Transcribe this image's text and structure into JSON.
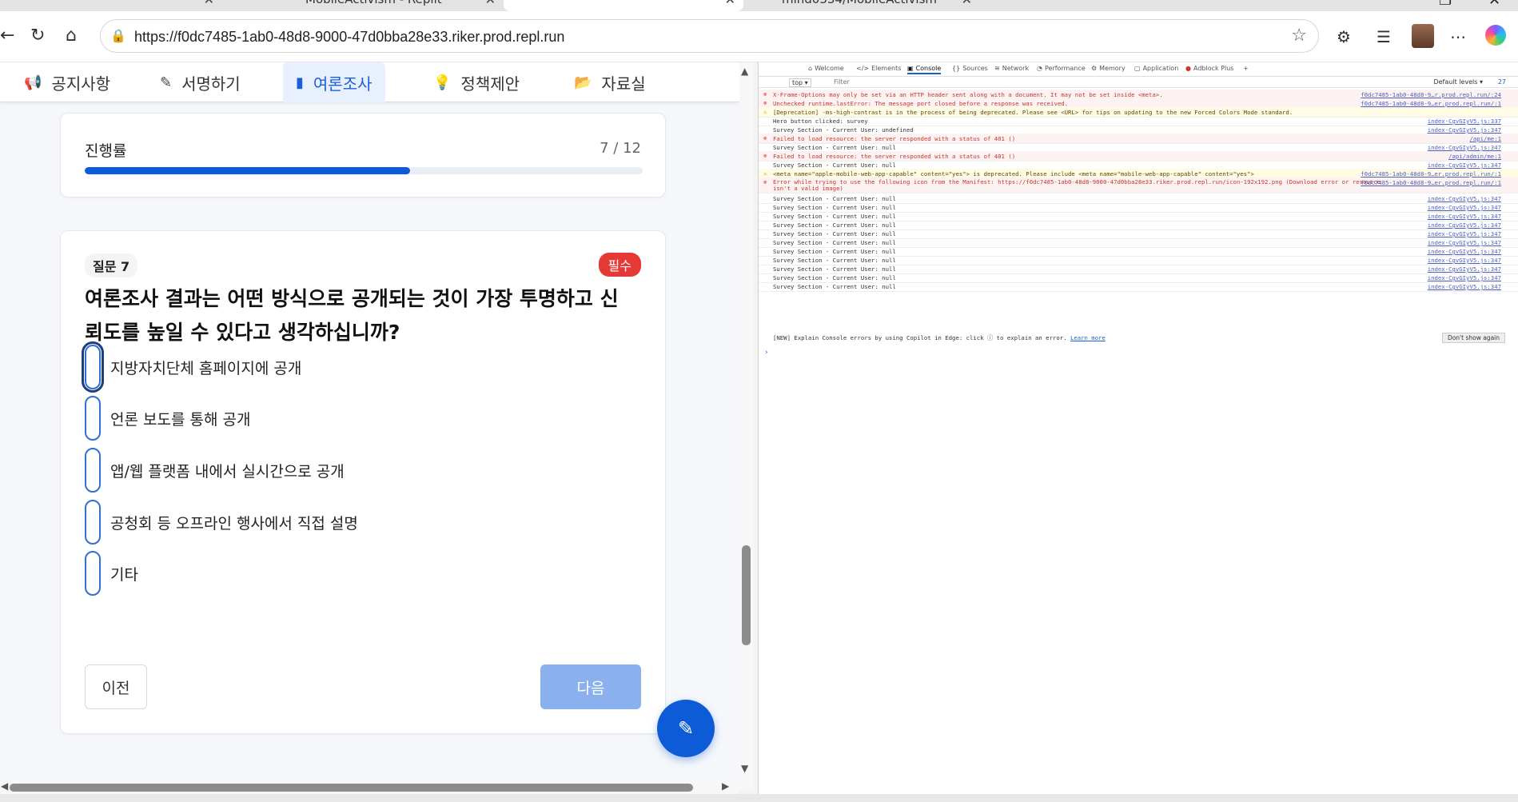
{
  "browser": {
    "tabs": [
      {
        "label": "",
        "active": false
      },
      {
        "label": "MobileActivism - Replit",
        "active": false
      },
      {
        "label": "",
        "active": true
      },
      {
        "label": "mind0334/MobileActivism",
        "active": false
      }
    ],
    "url": "https://f0dc7485-1ab0-48d8-9000-47d0bba28e33.riker.prod.repl.run"
  },
  "site_nav": {
    "items": [
      {
        "label": "공지사항",
        "icon": "megaphone-icon"
      },
      {
        "label": "서명하기",
        "icon": "pen-icon"
      },
      {
        "label": "여론조사",
        "icon": "bar-chart-icon",
        "active": true
      },
      {
        "label": "정책제안",
        "icon": "lightbulb-icon"
      },
      {
        "label": "자료실",
        "icon": "folder-icon"
      }
    ]
  },
  "progress": {
    "label": "진행률",
    "count": "7 / 12",
    "fraction": 0.583
  },
  "question": {
    "number_label": "질문 7",
    "required_label": "필수",
    "text": "여론조사 결과는 어떤 방식으로 공개되는 것이 가장 투명하고 신뢰도를 높일 수 있다고 생각하십니까?",
    "options": [
      "지방자치단체 홈페이지에 공개",
      "언론 보도를 통해 공개",
      "앱/웹 플랫폼 내에서 실시간으로 공개",
      "공청회 등 오프라인 행사에서 직접 설명",
      "기타"
    ],
    "prev_label": "이전",
    "next_label": "다음"
  },
  "devtools": {
    "tabs": [
      "Welcome",
      "Elements",
      "Console",
      "Sources",
      "Network",
      "Performance",
      "Memory",
      "Application",
      "Adblock Plus"
    ],
    "active_tab": "Console",
    "context": "top ▾",
    "filter_placeholder": "Filter",
    "levels": "Default levels ▾",
    "issue_count": "27",
    "logs": [
      {
        "type": "err",
        "msg": "X-Frame-Options may only be set via an HTTP header sent along with a document. It may not be set inside <meta>.",
        "src": "f0dc7485-1ab0-48d8-9…r.prod.repl.run/:24"
      },
      {
        "type": "err",
        "msg": "Unchecked runtime.lastError: The message port closed before a response was received.",
        "src": "f0dc7485-1ab0-48d8-9…er.prod.repl.run/:1"
      },
      {
        "type": "warn",
        "msg": "[Deprecation] -ms-high-contrast is in the process of being deprecated. Please see <URL> for tips on updating to the new Forced Colors Mode standard.",
        "src": ""
      },
      {
        "type": "info",
        "msg": "Hero button clicked: survey",
        "src": "index-CgvGIyV5.js:337"
      },
      {
        "type": "info",
        "msg": "Survey Section - Current User: undefined",
        "src": "index-CgvGIyV5.js:347"
      },
      {
        "type": "err",
        "msg": "Failed to load resource: the server responded with a status of 401 ()",
        "src": "/api/me:1"
      },
      {
        "type": "info",
        "msg": "Survey Section - Current User: null",
        "src": "index-CgvGIyV5.js:347"
      },
      {
        "type": "err",
        "msg": "Failed to load resource: the server responded with a status of 401 ()",
        "src": "/api/admin/me:1"
      },
      {
        "type": "info",
        "msg": "Survey Section - Current User: null",
        "src": "index-CgvGIyV5.js:347"
      },
      {
        "type": "warn",
        "msg": "<meta name=\"apple-mobile-web-app-capable\" content=\"yes\"> is deprecated. Please include <meta name=\"mobile-web-app-capable\" content=\"yes\">",
        "src": "f0dc7485-1ab0-48d8-9…er.prod.repl.run/:1"
      },
      {
        "type": "err",
        "msg": "Error while trying to use the following icon from the Manifest: https://f0dc7485-1ab0-48d8-9000-47d0bba28e33.riker.prod.repl.run/icon-192x192.png (Download error or resource isn't a valid image)",
        "src": "f0dc7485-1ab0-48d8-9…er.prod.repl.run/:1"
      },
      {
        "type": "info",
        "msg": "Survey Section - Current User: null",
        "src": "index-CgvGIyV5.js:347"
      },
      {
        "type": "info",
        "msg": "Survey Section - Current User: null",
        "src": "index-CgvGIyV5.js:347"
      },
      {
        "type": "info",
        "msg": "Survey Section - Current User: null",
        "src": "index-CgvGIyV5.js:347"
      },
      {
        "type": "info",
        "msg": "Survey Section - Current User: null",
        "src": "index-CgvGIyV5.js:347"
      },
      {
        "type": "info",
        "msg": "Survey Section - Current User: null",
        "src": "index-CgvGIyV5.js:347"
      },
      {
        "type": "info",
        "msg": "Survey Section - Current User: null",
        "src": "index-CgvGIyV5.js:347"
      },
      {
        "type": "info",
        "msg": "Survey Section - Current User: null",
        "src": "index-CgvGIyV5.js:347"
      },
      {
        "type": "info",
        "msg": "Survey Section - Current User: null",
        "src": "index-CgvGIyV5.js:347"
      },
      {
        "type": "info",
        "msg": "Survey Section - Current User: null",
        "src": "index-CgvGIyV5.js:347"
      },
      {
        "type": "info",
        "msg": "Survey Section - Current User: null",
        "src": "index-CgvGIyV5.js:347"
      },
      {
        "type": "info",
        "msg": "Survey Section - Current User: null",
        "src": "index-CgvGIyV5.js:347"
      }
    ],
    "copilot_tip": "[NEW] Explain Console errors by using Copilot in Edge: click ⓘ to explain an error.",
    "learn_more": "Learn more",
    "dont_show": "Don't show again"
  },
  "colors": {
    "accent": "#0d5bd7",
    "required": "#e53935",
    "next_disabled": "#8ab0ee"
  }
}
